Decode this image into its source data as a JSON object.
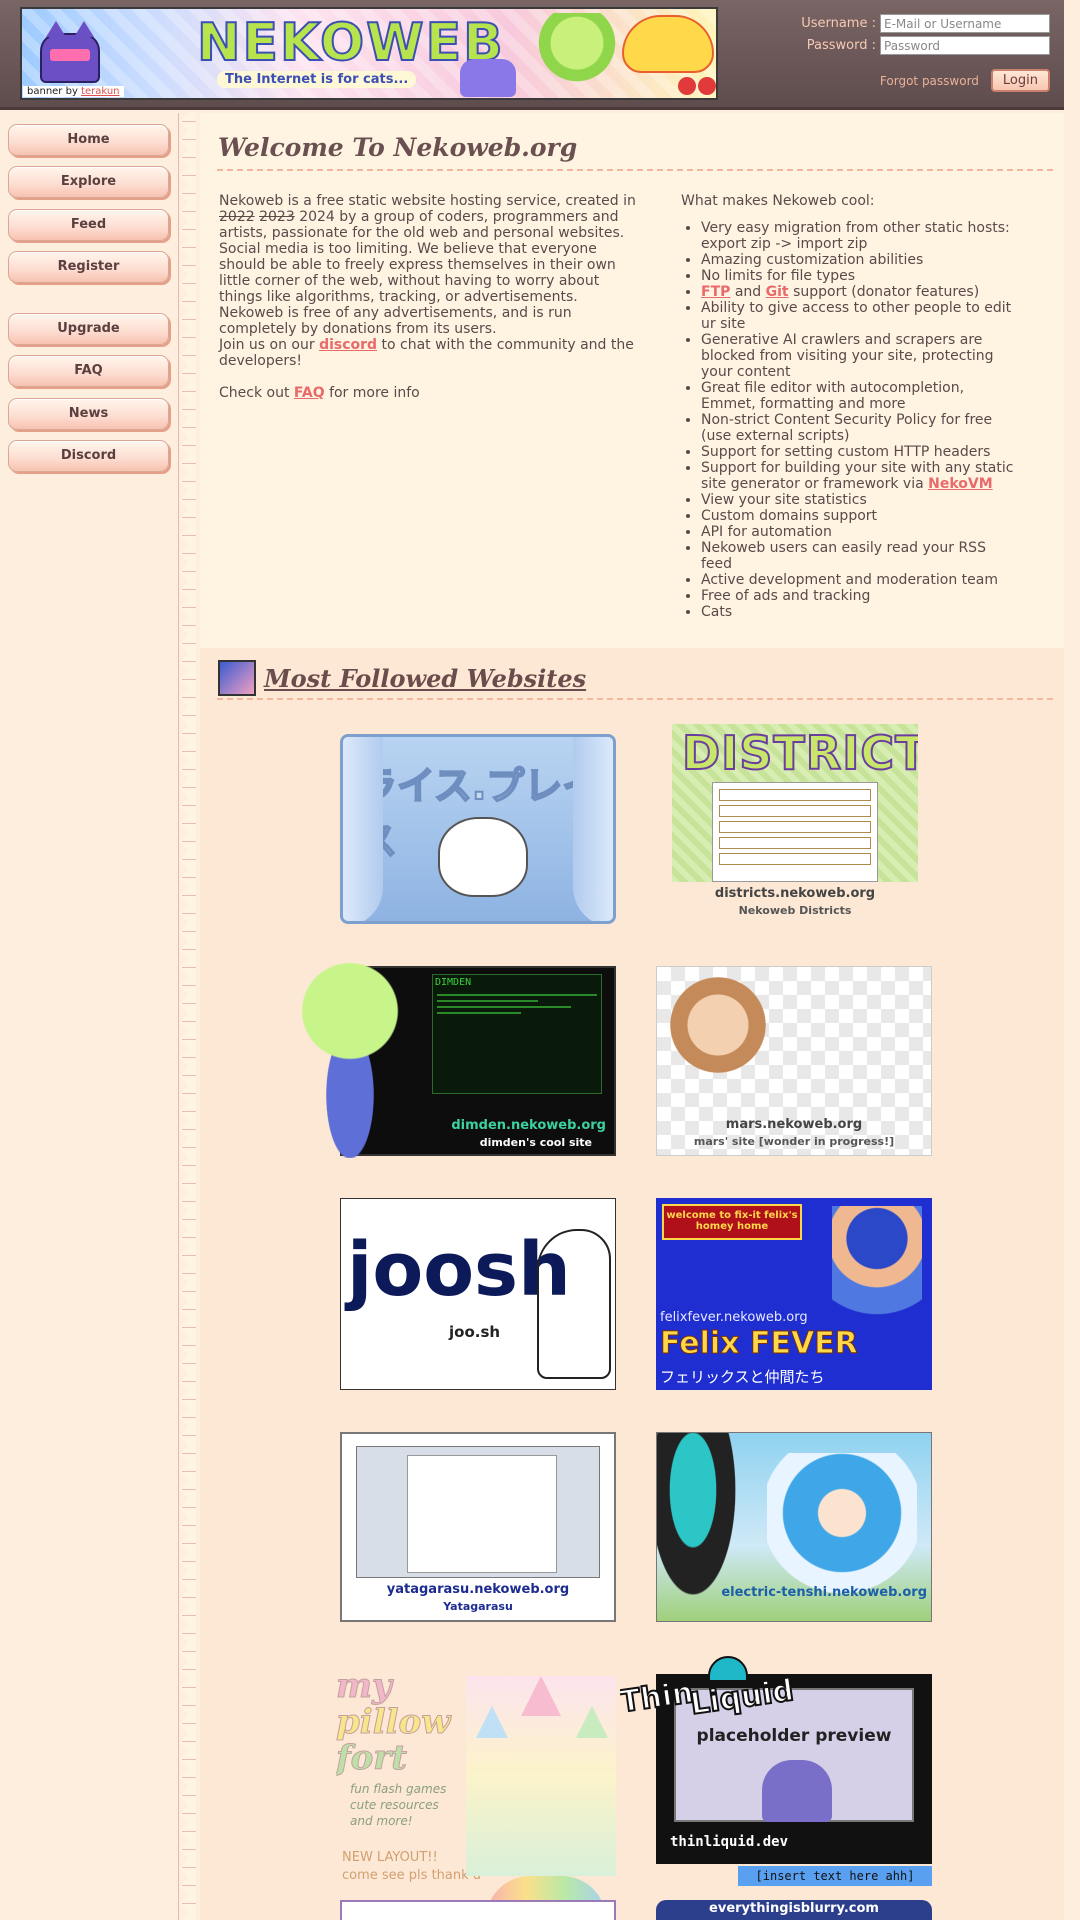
{
  "header": {
    "banner_credit_prefix": "banner by",
    "banner_credit_link": "terakun",
    "banner_logo_text": "NEKOWEB",
    "banner_tagline": "The Internet is for cats...",
    "login": {
      "username_label": "Username :",
      "username_placeholder": "E-Mail or Username",
      "password_label": "Password :",
      "password_placeholder": "Password",
      "forgot_label": "Forgot password",
      "login_button": "Login"
    }
  },
  "sidebar": {
    "items": [
      {
        "label": "Home"
      },
      {
        "label": "Explore"
      },
      {
        "label": "Feed"
      },
      {
        "label": "Register"
      },
      {
        "label": "Upgrade"
      },
      {
        "label": "FAQ"
      },
      {
        "label": "News"
      },
      {
        "label": "Discord"
      }
    ]
  },
  "welcome": {
    "title": "Welcome To Nekoweb.org",
    "intro_year_struck_1": "2022",
    "intro_year_struck_2": "2023",
    "intro_year": "2024",
    "intro_p1_start": "Nekoweb is a free static website hosting service, created in",
    "intro_p1_end": "by a group of coders, programmers and artists, passionate for the old web and personal websites.",
    "intro_p2": "Social media is too limiting. We believe that everyone should be able to freely express themselves in their own little corner of the web, without having to worry about things like algorithms, tracking, or advertisements.",
    "intro_p3": "Nekoweb is free of any advertisements, and is run completely by donations from its users.",
    "intro_p4_start": "Join us on our",
    "intro_p4_link": "discord",
    "intro_p4_end": "to chat with the community and the developers!",
    "intro_p5_start": "Check out",
    "intro_p5_link": "FAQ",
    "intro_p5_end": "for more info",
    "features_heading": "What makes Nekoweb cool:",
    "features": [
      "Very easy migration from other static hosts: export zip -> import zip",
      "Amazing customization abilities",
      "No limits for file types",
      "__FTPGIT__",
      "Ability to give access to other people to edit ur site",
      "Generative AI crawlers and scrapers are blocked from visiting your site, protecting your content",
      "Great file editor with autocompletion, Emmet, formatting and more",
      "Non-strict Content Security Policy for free (use external scripts)",
      "Support for setting custom HTTP headers",
      "__NEKOVM__",
      "View your site statistics",
      "Custom domains support",
      "API for automation",
      "Nekoweb users can easily read your RSS feed",
      "Active development and moderation team",
      "Free of ads and tracking",
      "Cats"
    ],
    "ftp_link": "FTP",
    "ftp_and": "and",
    "git_link": "Git",
    "ftp_suffix": "support (donator features)",
    "nekovm_prefix": "Support for building your site with any static site generator or framework via",
    "nekovm_link": "NekoVM"
  },
  "followed": {
    "title": "Most Followed Websites",
    "sites": [
      {
        "title": "ライス.プレイス"
      },
      {
        "logo": "DISTRICTS",
        "domain": "districts.nekoweb.org",
        "name": "Nekoweb Districts"
      },
      {
        "header": "DIMDEN",
        "domain": "dimden.nekoweb.org",
        "name": "dimden's cool site"
      },
      {
        "domain": "mars.nekoweb.org",
        "name": "mars' site [wonder in progress!]"
      },
      {
        "logo": "joosh",
        "domain": "joo.sh"
      },
      {
        "badge": "welcome to fix-it felix's homey home",
        "domain": "felixfever.nekoweb.org",
        "logo": "Felix FEVER",
        "sub": "フェリックスと仲間たち"
      },
      {
        "domain": "yatagarasu.nekoweb.org",
        "name": "Yatagarasu"
      },
      {
        "domain": "electric-tenshi.nekoweb.org"
      },
      {
        "line1": "my",
        "line2": "pillow",
        "line3": "fort",
        "tag1": "fun flash games",
        "tag2": "cute resources",
        "tag3": "and more!",
        "note1": "NEW LAYOUT!!",
        "note2": "come see pls thank u"
      },
      {
        "logo1": "Thin",
        "logo2": "Liquid",
        "caption": "placeholder preview",
        "domain": "thinliquid.dev",
        "footer": "[insert text here ahh]"
      },
      {},
      {
        "domain": "everythingisblurry.com"
      }
    ]
  }
}
